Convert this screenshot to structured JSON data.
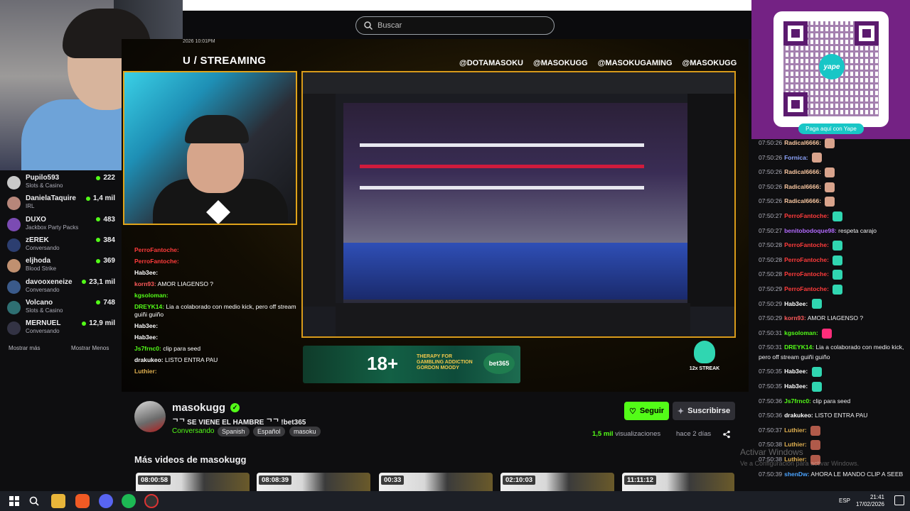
{
  "search": {
    "placeholder": "Buscar"
  },
  "stream_overlay": {
    "date": "2026 10:01PM",
    "title": "U / STREAMING",
    "socials": [
      "@DOTAMASOKU",
      "@MASOKUGG",
      "@MASOKUGAMING",
      "@MASOKUGG"
    ],
    "ad_age": "18+",
    "ad_therapy": "THERAPY FOR GAMBLING ADDICTION GORDON MOODY",
    "ad_brand": "bet365",
    "streak": "12x STREAK",
    "overlay_chat": [
      {
        "user": "PerroFantoche:",
        "text": "",
        "color": "#ff3b3b"
      },
      {
        "user": "PerroFantoche:",
        "text": "",
        "color": "#ff3b3b"
      },
      {
        "user": "Hab3ee:",
        "text": "",
        "color": "#ffffff"
      },
      {
        "user": "korn93:",
        "text": "AMOR LIAGENSO ?",
        "color": "#ff5a5a"
      },
      {
        "user": "kgsoloman:",
        "text": "",
        "color": "#53fc18"
      },
      {
        "user": "DREYK14:",
        "text": "Lia a colaborado con medio kick, pero off stream guiñi guiño",
        "color": "#53fc18"
      },
      {
        "user": "Hab3ee:",
        "text": "",
        "color": "#ffffff"
      },
      {
        "user": "Hab3ee:",
        "text": "",
        "color": "#ffffff"
      },
      {
        "user": "Js7frnc0:",
        "text": "clip para seed",
        "color": "#53fc18"
      },
      {
        "user": "drakukeo:",
        "text": "LISTO ENTRA PAU",
        "color": "#ffffff"
      },
      {
        "user": "Luthier:",
        "text": "",
        "color": "#e0b050"
      }
    ]
  },
  "sidebar": {
    "channels": [
      {
        "name": "Pupilo593",
        "category": "Slots & Casino",
        "viewers": "222",
        "avatar_color": "#c9c9c9"
      },
      {
        "name": "DanielaTaquire",
        "category": "IRL",
        "viewers": "1,4 mil",
        "avatar_color": "#b7867a"
      },
      {
        "name": "DUXO",
        "category": "Jackbox Party Packs",
        "viewers": "483",
        "avatar_color": "#7b4bb3"
      },
      {
        "name": "zEREK",
        "category": "Conversando",
        "viewers": "384",
        "avatar_color": "#2c3e70"
      },
      {
        "name": "eljhoda",
        "category": "Blood Strike",
        "viewers": "369",
        "avatar_color": "#c09070"
      },
      {
        "name": "davooxeneize",
        "category": "Conversando",
        "viewers": "23,1 mil",
        "avatar_color": "#3a5a8a"
      },
      {
        "name": "Volcano",
        "category": "Slots & Casino",
        "viewers": "748",
        "avatar_color": "#2e6f72"
      },
      {
        "name": "MERNUEL",
        "category": "Conversando",
        "viewers": "12,9 mil",
        "avatar_color": "#334"
      }
    ],
    "show_more": "Mostrar más",
    "show_less": "Mostrar Menos"
  },
  "qr": {
    "brand": "yape",
    "button": "Paga aquí con Yape"
  },
  "chat": [
    {
      "time": "07:50:26",
      "user": "Radical6666:",
      "text": "",
      "color": "#f7c59f",
      "emote": "#d8a38c"
    },
    {
      "time": "07:50:26",
      "user": "Fornica:",
      "text": "",
      "color": "#8fa6ff",
      "emote": "#d8a38c"
    },
    {
      "time": "07:50:26",
      "user": "Radical6666:",
      "text": "",
      "color": "#f7c59f",
      "emote": "#d8a38c"
    },
    {
      "time": "07:50:26",
      "user": "Radical6666:",
      "text": "",
      "color": "#f7c59f",
      "emote": "#d8a38c"
    },
    {
      "time": "07:50:26",
      "user": "Radical6666:",
      "text": "",
      "color": "#f7c59f",
      "emote": "#d8a38c"
    },
    {
      "time": "07:50:27",
      "user": "PerroFantoche:",
      "text": "",
      "color": "#ff3b3b",
      "emote": "#30d6b1"
    },
    {
      "time": "07:50:27",
      "user": "benitobodoque98:",
      "text": "respeta carajo",
      "color": "#b36bff",
      "emote": ""
    },
    {
      "time": "07:50:28",
      "user": "PerroFantoche:",
      "text": "",
      "color": "#ff3b3b",
      "emote": "#30d6b1"
    },
    {
      "time": "07:50:28",
      "user": "PerroFantoche:",
      "text": "",
      "color": "#ff3b3b",
      "emote": "#30d6b1"
    },
    {
      "time": "07:50:28",
      "user": "PerroFantoche:",
      "text": "",
      "color": "#ff3b3b",
      "emote": "#30d6b1"
    },
    {
      "time": "07:50:29",
      "user": "PerroFantoche:",
      "text": "",
      "color": "#ff3b3b",
      "emote": "#30d6b1"
    },
    {
      "time": "07:50:29",
      "user": "Hab3ee:",
      "text": "",
      "color": "#ffffff",
      "emote": "#30d6b1"
    },
    {
      "time": "07:50:29",
      "user": "korn93:",
      "text": "AMOR LIAGENSO ?",
      "color": "#ff5a5a",
      "emote": ""
    },
    {
      "time": "07:50:31",
      "user": "kgsoloman:",
      "text": "",
      "color": "#53fc18",
      "emote": "#ff2d7a"
    },
    {
      "time": "07:50:31",
      "user": "DREYK14:",
      "text": "Lia a colaborado con medio kick, pero off stream guiñi guiño",
      "color": "#53fc18",
      "emote": ""
    },
    {
      "time": "07:50:35",
      "user": "Hab3ee:",
      "text": "",
      "color": "#ffffff",
      "emote": "#30d6b1"
    },
    {
      "time": "07:50:35",
      "user": "Hab3ee:",
      "text": "",
      "color": "#ffffff",
      "emote": "#30d6b1"
    },
    {
      "time": "07:50:36",
      "user": "Js7frnc0:",
      "text": "clip para seed",
      "color": "#53fc18",
      "emote": ""
    },
    {
      "time": "07:50:36",
      "user": "drakukeo:",
      "text": "LISTO ENTRA PAU",
      "color": "#ffffff",
      "emote": ""
    },
    {
      "time": "07:50:37",
      "user": "Luthier:",
      "text": "",
      "color": "#e0b050",
      "emote": "#b05a4a"
    },
    {
      "time": "07:50:38",
      "user": "Luthier:",
      "text": "",
      "color": "#e0b050",
      "emote": "#b05a4a"
    },
    {
      "time": "07:50:38",
      "user": "Luthier:",
      "text": "",
      "color": "#e0b050",
      "emote": "#b05a4a"
    },
    {
      "time": "07:50:39",
      "user": "shenDw:",
      "text": "AHORA LE MANDO CLIP A SEEB",
      "color": "#4aa3ff",
      "emote": ""
    }
  ],
  "channel": {
    "name": "masokugg",
    "stream_title": "ᄀᄀ SE VIENE EL HAMBRE ᄀᄀ !bet365",
    "category": "Conversando",
    "tags": [
      "Spanish",
      "Español",
      "masoku"
    ],
    "follow": "Seguir",
    "subscribe": "Suscribirse",
    "views_count": "1,5 mil",
    "views_label": "visualizaciones",
    "ago": "hace 2 días",
    "more_videos": "Más videos de masokugg",
    "video_durations": [
      "08:00:58",
      "08:08:39",
      "00:33",
      "02:10:03",
      "11:11:12"
    ]
  },
  "windows_watermark": {
    "title": "Activar Windows",
    "subtitle": "Ve a Configuración para activar Windows."
  },
  "taskbar": {
    "lang": "ESP",
    "time": "21:41",
    "date": "17/02/2026"
  }
}
